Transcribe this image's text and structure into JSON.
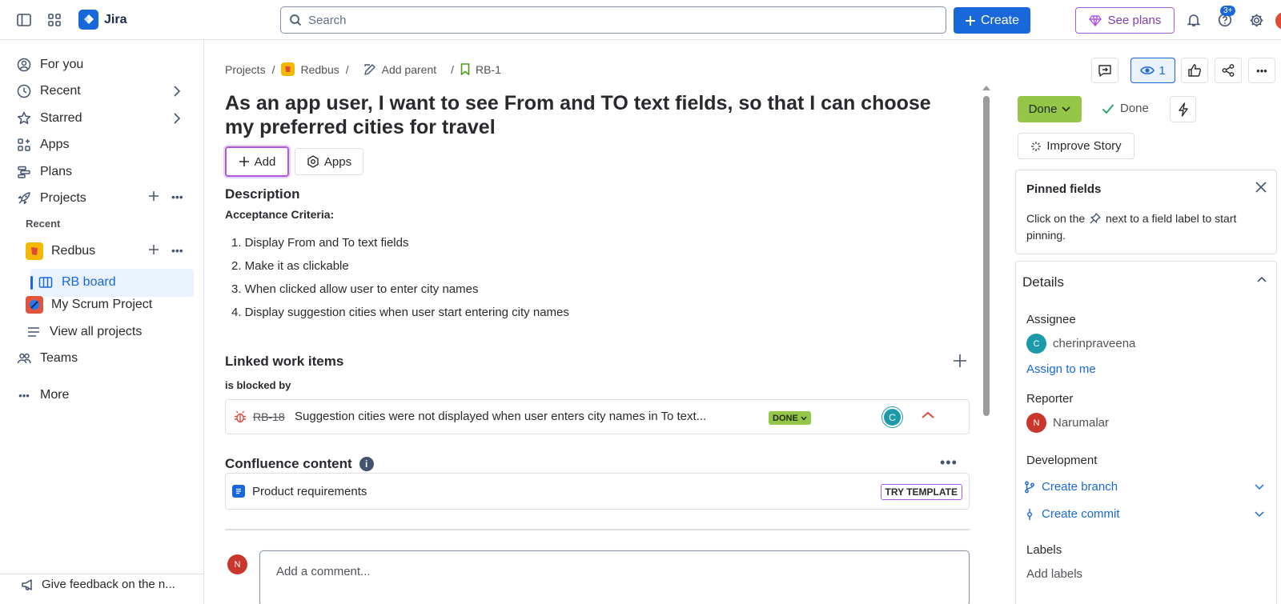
{
  "topbar": {
    "app_name": "Jira",
    "search_placeholder": "Search",
    "create_label": "Create",
    "plans_label": "See plans",
    "help_badge": "3+"
  },
  "sidebar": {
    "items": [
      {
        "label": "For you"
      },
      {
        "label": "Recent"
      },
      {
        "label": "Starred"
      },
      {
        "label": "Apps"
      },
      {
        "label": "Plans"
      },
      {
        "label": "Projects"
      }
    ],
    "recent_header": "Recent",
    "projects": [
      {
        "label": "Redbus"
      },
      {
        "label": "RB board"
      },
      {
        "label": "My Scrum Project"
      },
      {
        "label": "View all projects"
      }
    ],
    "teams_label": "Teams",
    "more_label": "More",
    "feedback_label": "Give feedback on the n..."
  },
  "breadcrumb": {
    "projects": "Projects",
    "project": "Redbus",
    "add_parent": "Add parent",
    "issue_key": "RB-1"
  },
  "issue": {
    "title": "As an app user, I want to see From and TO text fields, so that I can choose my preferred cities for travel",
    "add_label": "Add",
    "apps_label": "Apps",
    "description_heading": "Description",
    "acceptance_heading": "Acceptance Criteria:",
    "criteria": [
      "1. Display From and To text fields",
      "2. Make it as clickable",
      "3. When clicked allow user to enter city names",
      "4. Display suggestion cities when user start entering city names"
    ]
  },
  "linked": {
    "heading": "Linked work items",
    "relation": "is blocked by",
    "item": {
      "key": "RB-18",
      "summary": "Suggestion cities were not displayed when user enters city names in To text...",
      "status": "DONE",
      "assignee_initial": "C"
    }
  },
  "confluence": {
    "heading": "Confluence content",
    "item_label": "Product requirements",
    "template_label": "TRY TEMPLATE"
  },
  "comment": {
    "avatar_initial": "N",
    "placeholder": "Add a comment..."
  },
  "right_panel": {
    "watchers_count": "1",
    "status_label": "Done",
    "resolution_label": "Done",
    "improve_label": "Improve Story",
    "pinned": {
      "heading": "Pinned fields",
      "text_before": "Click on the",
      "text_after": "next to a field label to start pinning."
    },
    "details": {
      "heading": "Details",
      "assignee_label": "Assignee",
      "assignee_name": "cherinpraveena",
      "assignee_initial": "C",
      "assign_to_me": "Assign to me",
      "reporter_label": "Reporter",
      "reporter_name": "Narumalar",
      "reporter_initial": "N",
      "development_label": "Development",
      "create_branch": "Create branch",
      "create_commit": "Create commit",
      "labels_label": "Labels",
      "add_labels": "Add labels"
    }
  },
  "colors": {
    "brand_blue": "#1868db",
    "done_green": "#94c748",
    "plans_purple": "#af59e1"
  }
}
